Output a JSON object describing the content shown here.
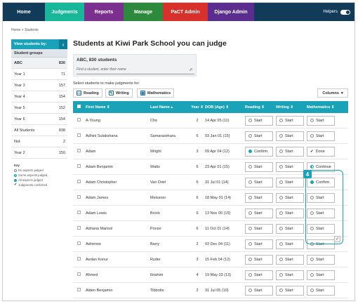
{
  "nav": {
    "tabs": [
      {
        "label": "Home",
        "color": "#1aa3b8"
      },
      {
        "label": "Judgments",
        "color": "#17b89a"
      },
      {
        "label": "Reports",
        "color": "#7b2f8e"
      },
      {
        "label": "Manage",
        "color": "#2d8a3c"
      },
      {
        "label": "PaCT Admin",
        "color": "#d8312b"
      },
      {
        "label": "Django Admin",
        "color": "#5b2d8e"
      }
    ],
    "helpers_label": "Helpers"
  },
  "breadcrumb": "Home > Students",
  "sidebar": {
    "header": "View students by:",
    "subheader": "Student groups",
    "items": [
      {
        "label": "ABC",
        "count": "830"
      },
      {
        "label": "Year 1",
        "count": "71"
      },
      {
        "label": "Year 3",
        "count": "157"
      },
      {
        "label": "Year 4",
        "count": "154"
      },
      {
        "label": "Year 5",
        "count": "152"
      },
      {
        "label": "Year 6",
        "count": "154"
      },
      {
        "label": "All Students",
        "count": "838"
      },
      {
        "label": "Not",
        "count": "2"
      },
      {
        "label": "Year 2",
        "count": "150"
      }
    ],
    "key": {
      "title": "Key",
      "items": [
        "No aspects judged",
        "Some aspects judged",
        "All aspects judged",
        "Judgments confirmed"
      ]
    }
  },
  "main": {
    "title": "Students at Kiwi Park School you can judge",
    "count_label": "ABC, 830 students",
    "search_placeholder": "Find a student, enter their name",
    "select_label": "Select students to make judgments for:",
    "subjects": [
      "Reading",
      "Writing",
      "Mathematics"
    ],
    "columns_label": "Columns",
    "callout_number": "4",
    "table": {
      "headers": [
        "First Name",
        "Last Name",
        "Year",
        "DOB (Age)",
        "Reading",
        "Writing",
        "Mathematics"
      ],
      "rows": [
        {
          "first": "A-Young",
          "last": "Cho",
          "year": "2",
          "dob": "14 Apr 05 (11)",
          "reading": "Start",
          "writing": "Start",
          "math": "Start"
        },
        {
          "first": "Adhini Sulakshana",
          "last": "Samarasekara",
          "year": "6",
          "dob": "03 Jan 01 (15)",
          "reading": "Start",
          "writing": "Start",
          "math": "Start"
        },
        {
          "first": "Adam",
          "last": "Wright",
          "year": "3",
          "dob": "09 Apr 04 (12)",
          "reading": "Confirm",
          "writing": "Start",
          "math": "Done"
        },
        {
          "first": "Adam Benjamin",
          "last": "Watts",
          "year": "6",
          "dob": "23 Apr 01 (15)",
          "reading": "Start",
          "writing": "Start",
          "math": "Continue"
        },
        {
          "first": "Adam Christopher",
          "last": "Van Driel",
          "year": "6",
          "dob": "31 Jul 01 (14)",
          "reading": "Start",
          "writing": "Start",
          "math": "Confirm"
        },
        {
          "first": "Adam James",
          "last": "Meissner",
          "year": "6",
          "dob": "18 May 01 (14)",
          "reading": "Start",
          "writing": "Start",
          "math": "Start"
        },
        {
          "first": "Adam Lewis",
          "last": "Brock",
          "year": "6",
          "dob": "13 Nov 00 (15)",
          "reading": "Start",
          "writing": "Start",
          "math": "Start"
        },
        {
          "first": "Adriana Marisol",
          "last": "Ponze",
          "year": "6",
          "dob": "11 Oct 01 (14)",
          "reading": "Start",
          "writing": "Start",
          "math": "Start"
        },
        {
          "first": "Adrienne",
          "last": "Barry",
          "year": "2",
          "dob": "03 Dec 04 (11)",
          "reading": "Start",
          "writing": "Start",
          "math": "Start"
        },
        {
          "first": "Aedan Konur",
          "last": "Ryder",
          "year": "3",
          "dob": "15 Feb 04 (12)",
          "reading": "Start",
          "writing": "Start",
          "math": "Start"
        },
        {
          "first": "Ahmed",
          "last": "Ibrahim",
          "year": "4",
          "dob": "19 May 03 (13)",
          "reading": "Start",
          "writing": "Start",
          "math": "Start"
        },
        {
          "first": "Aiden Benjamin",
          "last": "Tibbotts",
          "year": "2",
          "dob": "31 Jul 05 (10)",
          "reading": "Start",
          "writing": "Start",
          "math": "Start"
        }
      ]
    }
  }
}
